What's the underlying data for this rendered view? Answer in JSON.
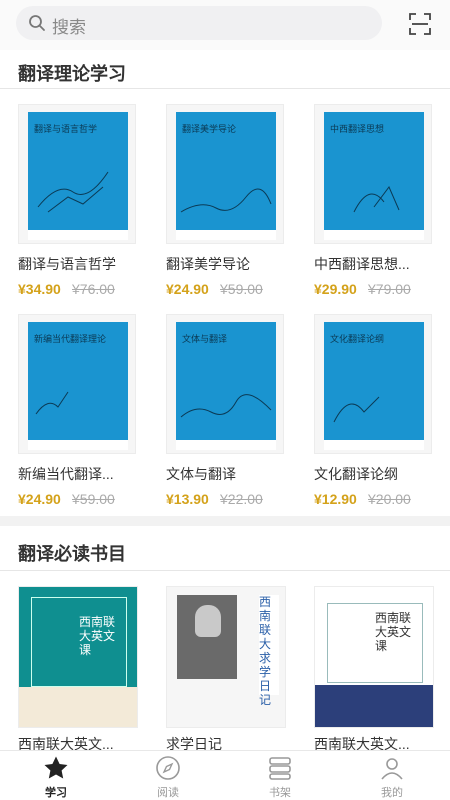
{
  "search": {
    "placeholder": "搜索"
  },
  "sections": [
    {
      "title": "翻译理论学习",
      "books": [
        {
          "title": "翻译与语言哲学",
          "cover_title": "翻译与语言哲学",
          "price": "¥34.90",
          "old_price": "¥76.00"
        },
        {
          "title": "翻译美学导论",
          "cover_title": "翻译美学导论",
          "price": "¥24.90",
          "old_price": "¥59.00"
        },
        {
          "title": "中西翻译思想...",
          "cover_title": "中西翻译思想",
          "price": "¥29.90",
          "old_price": "¥79.00"
        },
        {
          "title": "新编当代翻译...",
          "cover_title": "新编当代翻译理论",
          "price": "¥24.90",
          "old_price": "¥59.00"
        },
        {
          "title": "文体与翻译",
          "cover_title": "文体与翻译",
          "price": "¥13.90",
          "old_price": "¥22.00"
        },
        {
          "title": "文化翻译论纲",
          "cover_title": "文化翻译论纲",
          "price": "¥12.90",
          "old_price": "¥20.00"
        }
      ]
    },
    {
      "title": "翻译必读书目",
      "books": [
        {
          "title": "西南联大英文...",
          "cover_title": "西南联大英文课"
        },
        {
          "title": "求学日记",
          "cover_title": "西南联大求学日记"
        },
        {
          "title": "西南联大英文...",
          "cover_title": "西南联大英文课"
        }
      ]
    }
  ],
  "tabs": [
    {
      "label": "学习",
      "icon": "star-icon",
      "active": true
    },
    {
      "label": "阅读",
      "icon": "compass-icon",
      "active": false
    },
    {
      "label": "书架",
      "icon": "bookshelf-icon",
      "active": false
    },
    {
      "label": "我的",
      "icon": "person-icon",
      "active": false
    }
  ],
  "colors": {
    "accent": "#d4a21a",
    "cover_blue": "#1a94d0",
    "teal_cover": "#0f8f90"
  }
}
